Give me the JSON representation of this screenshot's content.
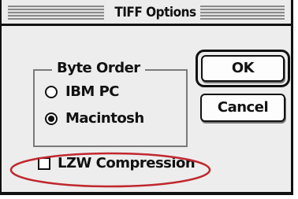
{
  "window": {
    "title": "TIFF Options"
  },
  "byte_order": {
    "label": "Byte Order",
    "options": [
      {
        "label": "IBM PC",
        "selected": false
      },
      {
        "label": "Macintosh",
        "selected": true
      }
    ]
  },
  "buttons": {
    "ok_label": "OK",
    "cancel_label": "Cancel"
  },
  "lzw": {
    "label": "LZW Compression",
    "checked": false
  },
  "annotation": {
    "color": "#c0282e"
  }
}
